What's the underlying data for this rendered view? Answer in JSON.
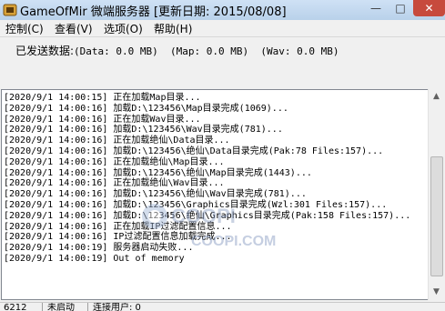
{
  "window": {
    "title": "GameOfMir 微端服务器 [更新日期: 2015/08/08]",
    "minimize_glyph": "—",
    "maximize_glyph": "□",
    "close_glyph": "✕"
  },
  "menu": [
    {
      "label": "控制(C)"
    },
    {
      "label": "查看(V)"
    },
    {
      "label": "选项(O)"
    },
    {
      "label": "帮助(H)"
    }
  ],
  "sent": {
    "label": "已发送数据:",
    "values": "(Data: 0.0 MB)  (Map: 0.0 MB)  (Wav: 0.0 MB)"
  },
  "log": [
    "[2020/9/1 14:00:15] 正在加载Map目录...",
    "[2020/9/1 14:00:16] 加载D:\\123456\\Map目录完成(1069)...",
    "[2020/9/1 14:00:16] 正在加载Wav目录...",
    "[2020/9/1 14:00:16] 加载D:\\123456\\Wav目录完成(781)...",
    "[2020/9/1 14:00:16] 正在加载绝仙\\Data目录...",
    "[2020/9/1 14:00:16] 加载D:\\123456\\绝仙\\Data目录完成(Pak:78 Files:157)...",
    "[2020/9/1 14:00:16] 正在加载绝仙\\Map目录...",
    "[2020/9/1 14:00:16] 加载D:\\123456\\绝仙\\Map目录完成(1443)...",
    "[2020/9/1 14:00:16] 正在加载绝仙\\Wav目录...",
    "[2020/9/1 14:00:16] 加载D:\\123456\\绝仙\\Wav目录完成(781)...",
    "[2020/9/1 14:00:16] 加载D:\\123456\\Graphics目录完成(Wzl:301 Files:157)...",
    "[2020/9/1 14:00:16] 加载D:\\123456\\绝仙\\Graphics目录完成(Pak:158 Files:157)...",
    "[2020/9/1 14:00:16] 正在加载IP过滤配置信息...",
    "[2020/9/1 14:00:16] IP过滤配置信息加载完成...",
    "[2020/9/1 14:00:19] 服务器启动失败...",
    "[2020/9/1 14:00:19] Out of memory"
  ],
  "watermark": {
    "text": "COOPI.COM"
  },
  "statusbar": {
    "segments": [
      "6212",
      "未启动",
      "连接用户: 0"
    ]
  },
  "icons": {
    "app": "app-icon",
    "scroll_up": "scroll-up-arrow-icon",
    "scroll_down": "scroll-down-arrow-icon"
  },
  "colors": {
    "close_button": "#c74a3d",
    "titlebar": "#b9d1ea"
  }
}
